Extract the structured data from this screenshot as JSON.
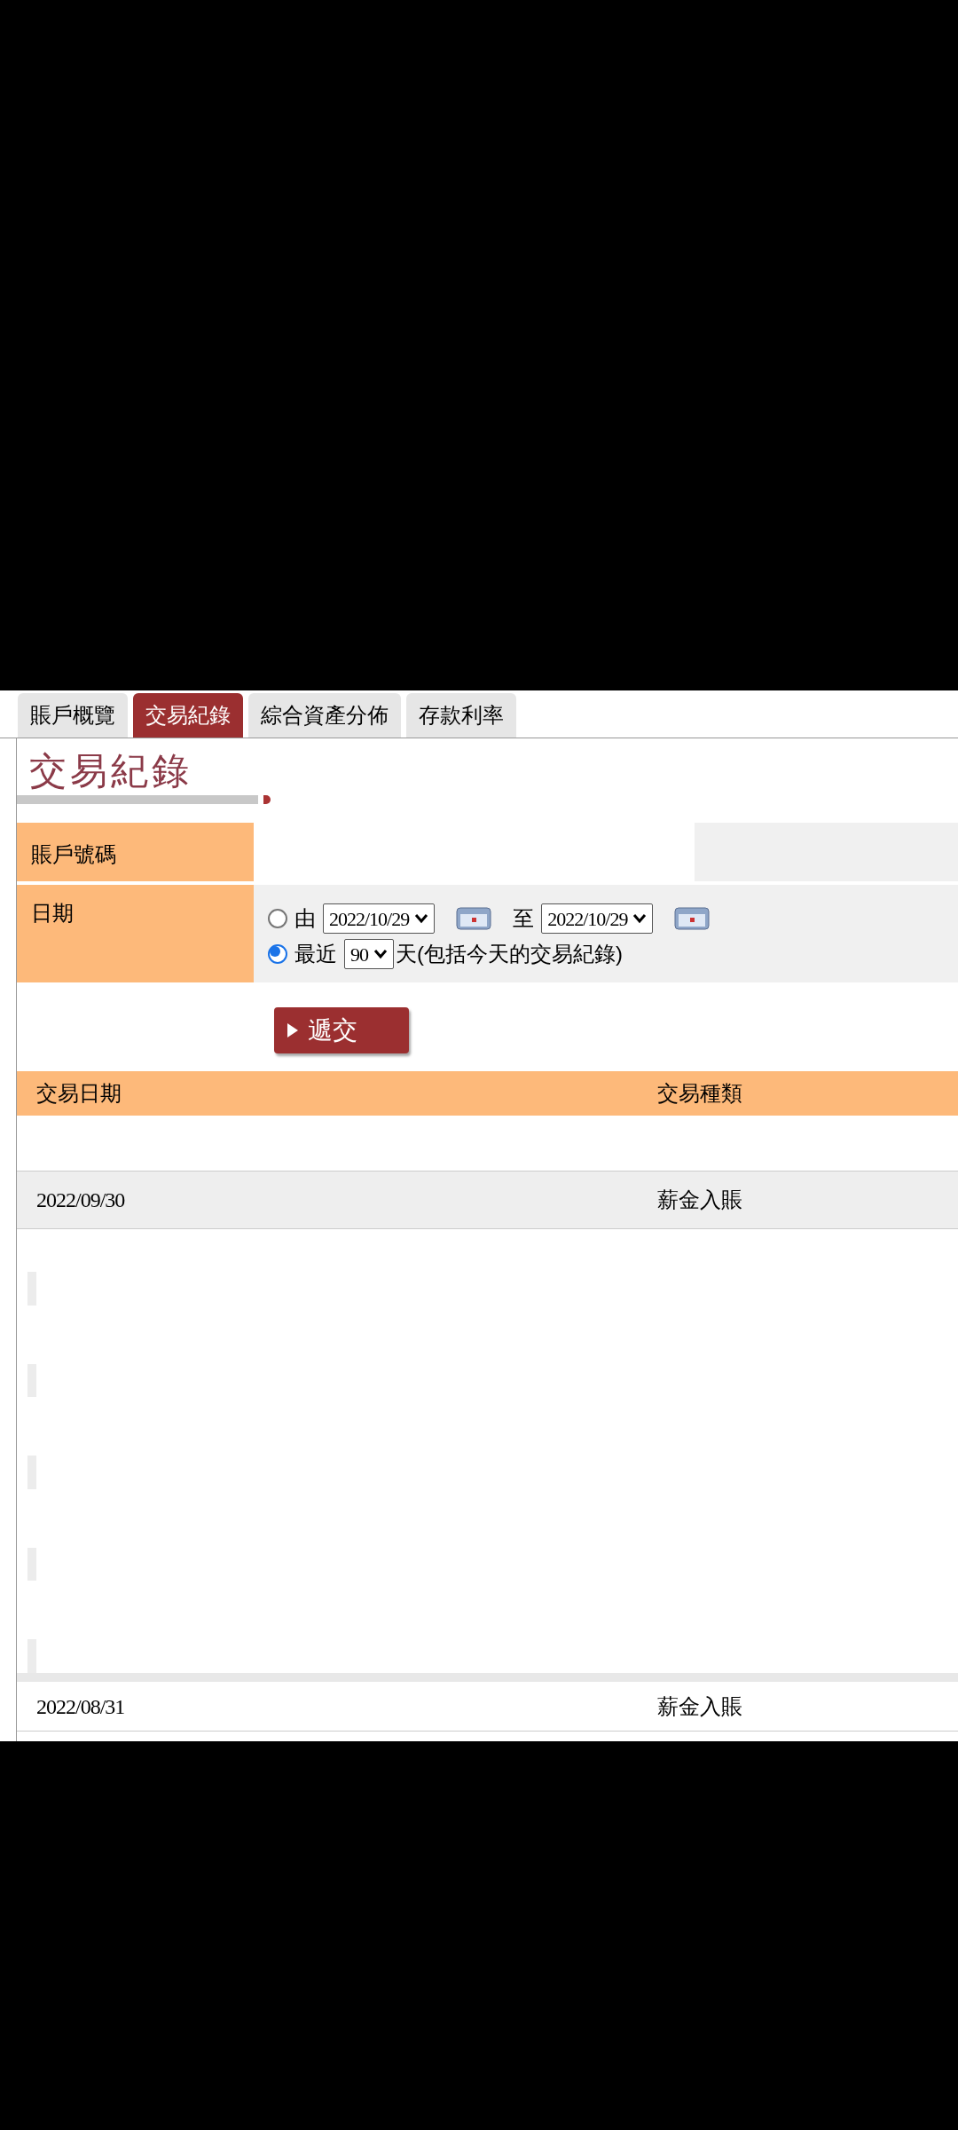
{
  "tabs": [
    {
      "label": "賬戶概覽",
      "selected": false
    },
    {
      "label": "交易紀錄",
      "selected": true
    },
    {
      "label": "綜合資產分佈",
      "selected": false
    },
    {
      "label": "存款利率",
      "selected": false
    }
  ],
  "page_title": "交易紀錄",
  "form": {
    "account_label": "賬戶號碼",
    "date_label": "日期",
    "date_options": [
      {
        "kind": "range",
        "selected": false,
        "from_label": "由",
        "from_value": "2022/10/29",
        "to_label": "至",
        "to_value": "2022/10/29"
      },
      {
        "kind": "recent",
        "selected": true,
        "prefix": "最近",
        "days": "90",
        "suffix": "天(包括今天的交易紀錄)"
      }
    ],
    "submit_button": "遞交"
  },
  "table": {
    "columns": [
      "交易日期",
      "交易種類"
    ],
    "rows": [
      {
        "date": "2022/09/30",
        "type": "薪金入賬",
        "expanded": true
      },
      {
        "date": "2022/08/31",
        "type": "薪金入賬",
        "expanded": false
      }
    ]
  }
}
